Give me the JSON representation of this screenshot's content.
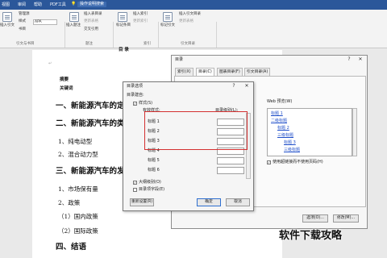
{
  "tabbar": {
    "tabs": [
      "视图",
      "审阅",
      "帮助",
      "PDF工具"
    ],
    "search": "操作说明搜索"
  },
  "ribbon": {
    "insert_footnote": "插入引文",
    "manage_sources": "管理源",
    "style_label": "样式",
    "style_value": "APA",
    "bibliography": "书目",
    "insert_caption": "插入题注",
    "insert_table_of_figures": "插入表目录",
    "update_table": "更新表格",
    "cross_reference": "交叉引用",
    "mark_entry": "标记条目",
    "insert_index": "插入索引",
    "update_index": "更新索引",
    "mark_citation": "标记引文",
    "insert_table_of_authorities": "插入引文目录",
    "update_table_of_authorities": "更新表格",
    "group_citations": "引文与书目",
    "group_captions": "题注",
    "group_index": "索引",
    "group_authorities": "引文目录"
  },
  "document": {
    "title": "目  录",
    "abstract": "摘要",
    "keywords": "关键词",
    "heading1": "一、新能源汽车的定",
    "heading2": "二、新能源汽车的类",
    "item1": "1、纯电动型",
    "item2": "2、混合动力型",
    "heading3": "三、新能源汽车的发",
    "item3": "1、市场保有量",
    "item4": "2、政策",
    "item5": "（1）国内政策",
    "item6": "（2）国际政策",
    "heading4": "四、结语",
    "para_mark": "↵"
  },
  "toc_dialog": {
    "title": "目录",
    "help": "?",
    "close": "✕",
    "tabs": [
      "索引(X)",
      "目录(C)",
      "图表目录(F)",
      "引文目录(A)"
    ],
    "web_preview_label": "Web 预览(W)",
    "preview_links": [
      "标题 1",
      "二级标题",
      "标题 2",
      "三级标题",
      "标题 3",
      "三级标题"
    ],
    "use_hyperlinks": "使用超链接而不使用页码(H)",
    "options_button": "选项(O)...",
    "modify_button": "修改(M)..."
  },
  "options_dialog": {
    "title": "目录选项",
    "help": "?",
    "close": "✕",
    "build_from": "目录建自:",
    "styles_checkbox": "样式(S)",
    "available_styles": "有效样式:",
    "toc_level": "目录级别(L):",
    "levels": [
      {
        "name": "标题 1",
        "value": ""
      },
      {
        "name": "标题 2",
        "value": ""
      },
      {
        "name": "标题 3",
        "value": ""
      },
      {
        "name": "标题 4",
        "value": ""
      },
      {
        "name": "标题 5",
        "value": ""
      },
      {
        "name": "标题 6",
        "value": ""
      }
    ],
    "outline_levels": "大纲级别(O)",
    "entry_fields": "目录项字段(E)",
    "reset_button": "重新设置(R)",
    "ok_button": "确定",
    "cancel_button": "取消"
  },
  "watermark": "软件下载攻略",
  "colors": {
    "ribbon_blue": "#2b579a",
    "hyperlink": "#1f4ec9",
    "highlight_red": "#d43131"
  }
}
